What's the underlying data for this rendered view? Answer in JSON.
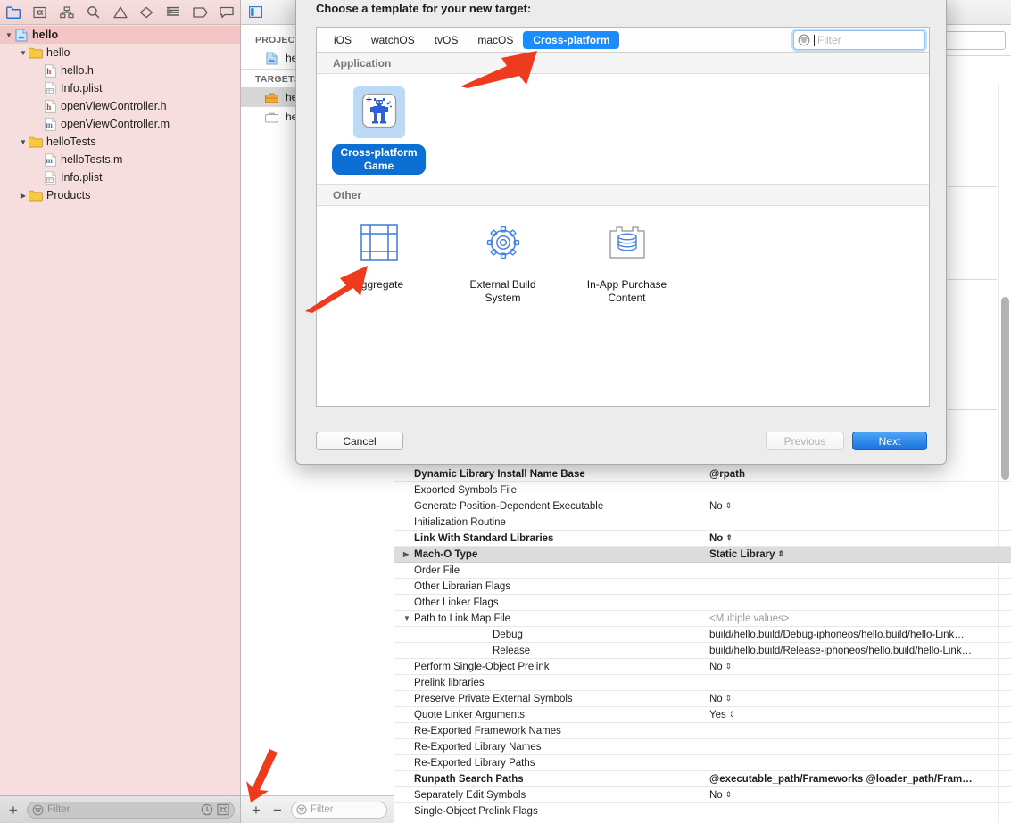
{
  "navigator": {
    "toolbar_icons": [
      {
        "name": "project-navigator-icon",
        "active": true
      },
      {
        "name": "source-control-navigator-icon",
        "active": false
      },
      {
        "name": "symbol-navigator-icon",
        "active": false
      },
      {
        "name": "find-navigator-icon",
        "active": false
      },
      {
        "name": "issue-navigator-icon",
        "active": false
      },
      {
        "name": "test-navigator-icon",
        "active": false
      },
      {
        "name": "debug-navigator-icon",
        "active": false
      },
      {
        "name": "breakpoint-navigator-icon",
        "active": false
      },
      {
        "name": "report-navigator-icon",
        "active": false
      }
    ],
    "tree": [
      {
        "label": "hello",
        "depth": 0,
        "icon": "project-icon",
        "twisty": "down",
        "selected": true
      },
      {
        "label": "hello",
        "depth": 1,
        "icon": "folder-icon",
        "twisty": "down",
        "selected": false
      },
      {
        "label": "hello.h",
        "depth": 2,
        "icon": "header-file-icon",
        "twisty": "none",
        "selected": false
      },
      {
        "label": "Info.plist",
        "depth": 2,
        "icon": "plist-file-icon",
        "twisty": "none",
        "selected": false
      },
      {
        "label": "openViewController.h",
        "depth": 2,
        "icon": "header-file-icon",
        "twisty": "none",
        "selected": false
      },
      {
        "label": "openViewController.m",
        "depth": 2,
        "icon": "source-file-icon",
        "twisty": "none",
        "selected": false
      },
      {
        "label": "helloTests",
        "depth": 1,
        "icon": "folder-icon",
        "twisty": "down",
        "selected": false
      },
      {
        "label": "helloTests.m",
        "depth": 2,
        "icon": "source-file-icon",
        "twisty": "none",
        "selected": false
      },
      {
        "label": "Info.plist",
        "depth": 2,
        "icon": "plist-file-icon",
        "twisty": "none",
        "selected": false
      },
      {
        "label": "Products",
        "depth": 1,
        "icon": "folder-icon",
        "twisty": "right",
        "selected": false
      }
    ],
    "filter": {
      "placeholder": "Filter",
      "add_label": "+",
      "recent_icon": "clock-icon",
      "source-control_icon": "scm-filter-icon"
    }
  },
  "project_list": {
    "project_header": "PROJECT",
    "project_items": [
      {
        "label": "hello",
        "icon": "project-file-icon"
      }
    ],
    "targets_header": "TARGETS",
    "target_items": [
      {
        "label": "hello",
        "icon": "app-target-icon",
        "selected": true
      },
      {
        "label": "helloTests",
        "icon": "test-target-icon",
        "selected": false
      }
    ],
    "add_label": "+",
    "remove_label": "−",
    "filter_placeholder": "Filter"
  },
  "build_settings": {
    "rows": [
      {
        "name": "Dynamic Library Install Name Base",
        "value": "@rpath",
        "bold": true,
        "stepper": false,
        "indent": 0,
        "highlight": false,
        "disclosure": "none"
      },
      {
        "name": "Exported Symbols File",
        "value": "",
        "bold": false,
        "stepper": false,
        "indent": 0,
        "highlight": false,
        "disclosure": "none"
      },
      {
        "name": "Generate Position-Dependent Executable",
        "value": "No",
        "bold": false,
        "stepper": true,
        "indent": 0,
        "highlight": false,
        "disclosure": "none"
      },
      {
        "name": "Initialization Routine",
        "value": "",
        "bold": false,
        "stepper": false,
        "indent": 0,
        "highlight": false,
        "disclosure": "none"
      },
      {
        "name": "Link With Standard Libraries",
        "value": "No",
        "bold": true,
        "stepper": true,
        "indent": 0,
        "highlight": false,
        "disclosure": "none"
      },
      {
        "name": "Mach-O Type",
        "value": "Static Library",
        "bold": true,
        "stepper": true,
        "indent": 0,
        "highlight": true,
        "disclosure": "right"
      },
      {
        "name": "Order File",
        "value": "",
        "bold": false,
        "stepper": false,
        "indent": 0,
        "highlight": false,
        "disclosure": "none"
      },
      {
        "name": "Other Librarian Flags",
        "value": "",
        "bold": false,
        "stepper": false,
        "indent": 0,
        "highlight": false,
        "disclosure": "none"
      },
      {
        "name": "Other Linker Flags",
        "value": "",
        "bold": false,
        "stepper": false,
        "indent": 0,
        "highlight": false,
        "disclosure": "none"
      },
      {
        "name": "Path to Link Map File",
        "value": "<Multiple values>",
        "bold": false,
        "stepper": false,
        "indent": 0,
        "highlight": false,
        "disclosure": "down",
        "muted": true
      },
      {
        "name": "Debug",
        "value": "build/hello.build/Debug-iphoneos/hello.build/hello-Link…",
        "bold": false,
        "stepper": false,
        "indent": 1,
        "highlight": false,
        "disclosure": "none"
      },
      {
        "name": "Release",
        "value": "build/hello.build/Release-iphoneos/hello.build/hello-Link…",
        "bold": false,
        "stepper": false,
        "indent": 1,
        "highlight": false,
        "disclosure": "none"
      },
      {
        "name": "Perform Single-Object Prelink",
        "value": "No",
        "bold": false,
        "stepper": true,
        "indent": 0,
        "highlight": false,
        "disclosure": "none"
      },
      {
        "name": "Prelink libraries",
        "value": "",
        "bold": false,
        "stepper": false,
        "indent": 0,
        "highlight": false,
        "disclosure": "none"
      },
      {
        "name": "Preserve Private External Symbols",
        "value": "No",
        "bold": false,
        "stepper": true,
        "indent": 0,
        "highlight": false,
        "disclosure": "none"
      },
      {
        "name": "Quote Linker Arguments",
        "value": "Yes",
        "bold": false,
        "stepper": true,
        "indent": 0,
        "highlight": false,
        "disclosure": "none"
      },
      {
        "name": "Re-Exported Framework Names",
        "value": "",
        "bold": false,
        "stepper": false,
        "indent": 0,
        "highlight": false,
        "disclosure": "none"
      },
      {
        "name": "Re-Exported Library Names",
        "value": "",
        "bold": false,
        "stepper": false,
        "indent": 0,
        "highlight": false,
        "disclosure": "none"
      },
      {
        "name": "Re-Exported Library Paths",
        "value": "",
        "bold": false,
        "stepper": false,
        "indent": 0,
        "highlight": false,
        "disclosure": "none"
      },
      {
        "name": "Runpath Search Paths",
        "value": "@executable_path/Frameworks @loader_path/Fram…",
        "bold": true,
        "stepper": false,
        "indent": 0,
        "highlight": false,
        "disclosure": "none"
      },
      {
        "name": "Separately Edit Symbols",
        "value": "No",
        "bold": false,
        "stepper": true,
        "indent": 0,
        "highlight": false,
        "disclosure": "none"
      },
      {
        "name": "Single-Object Prelink Flags",
        "value": "",
        "bold": false,
        "stepper": false,
        "indent": 0,
        "highlight": false,
        "disclosure": "none"
      }
    ]
  },
  "sheet": {
    "title": "Choose a template for your new target:",
    "platform_tabs": [
      {
        "label": "iOS",
        "active": false
      },
      {
        "label": "watchOS",
        "active": false
      },
      {
        "label": "tvOS",
        "active": false
      },
      {
        "label": "macOS",
        "active": false
      },
      {
        "label": "Cross-platform",
        "active": true
      }
    ],
    "filter": {
      "placeholder": "Filter",
      "value": "",
      "icon": "filter-icon"
    },
    "sections": [
      {
        "header": "Application",
        "templates": [
          {
            "label": "Cross-platform\nGame",
            "label_line1": "Cross-platform",
            "label_line2": "Game",
            "icon": "game-robot-icon",
            "selected": true
          }
        ]
      },
      {
        "header": "Other",
        "templates": [
          {
            "label_line1": "Aggregate",
            "label_line2": "",
            "icon": "aggregate-icon",
            "selected": false
          },
          {
            "label_line1": "External Build",
            "label_line2": "System",
            "icon": "gear-icon",
            "selected": false
          },
          {
            "label_line1": "In-App Purchase",
            "label_line2": "Content",
            "icon": "in-app-purchase-icon",
            "selected": false
          }
        ]
      }
    ],
    "buttons": {
      "cancel": "Cancel",
      "previous": "Previous",
      "next": "Next"
    },
    "colors": {
      "accent_blue": "#1a8cff",
      "selected_label_blue": "#0b6fd4",
      "next_button_blue": "#1a72de",
      "arrow_red": "#ee3b1e"
    }
  },
  "annotations": {
    "arrows": [
      {
        "name": "arrow-to-cross-platform-tab",
        "points_to": "Cross-platform",
        "direction": "up-right"
      },
      {
        "name": "arrow-to-aggregate-template",
        "points_to": "Aggregate",
        "direction": "up-right"
      },
      {
        "name": "arrow-to-add-target-button",
        "points_to": "+",
        "direction": "down"
      }
    ]
  }
}
